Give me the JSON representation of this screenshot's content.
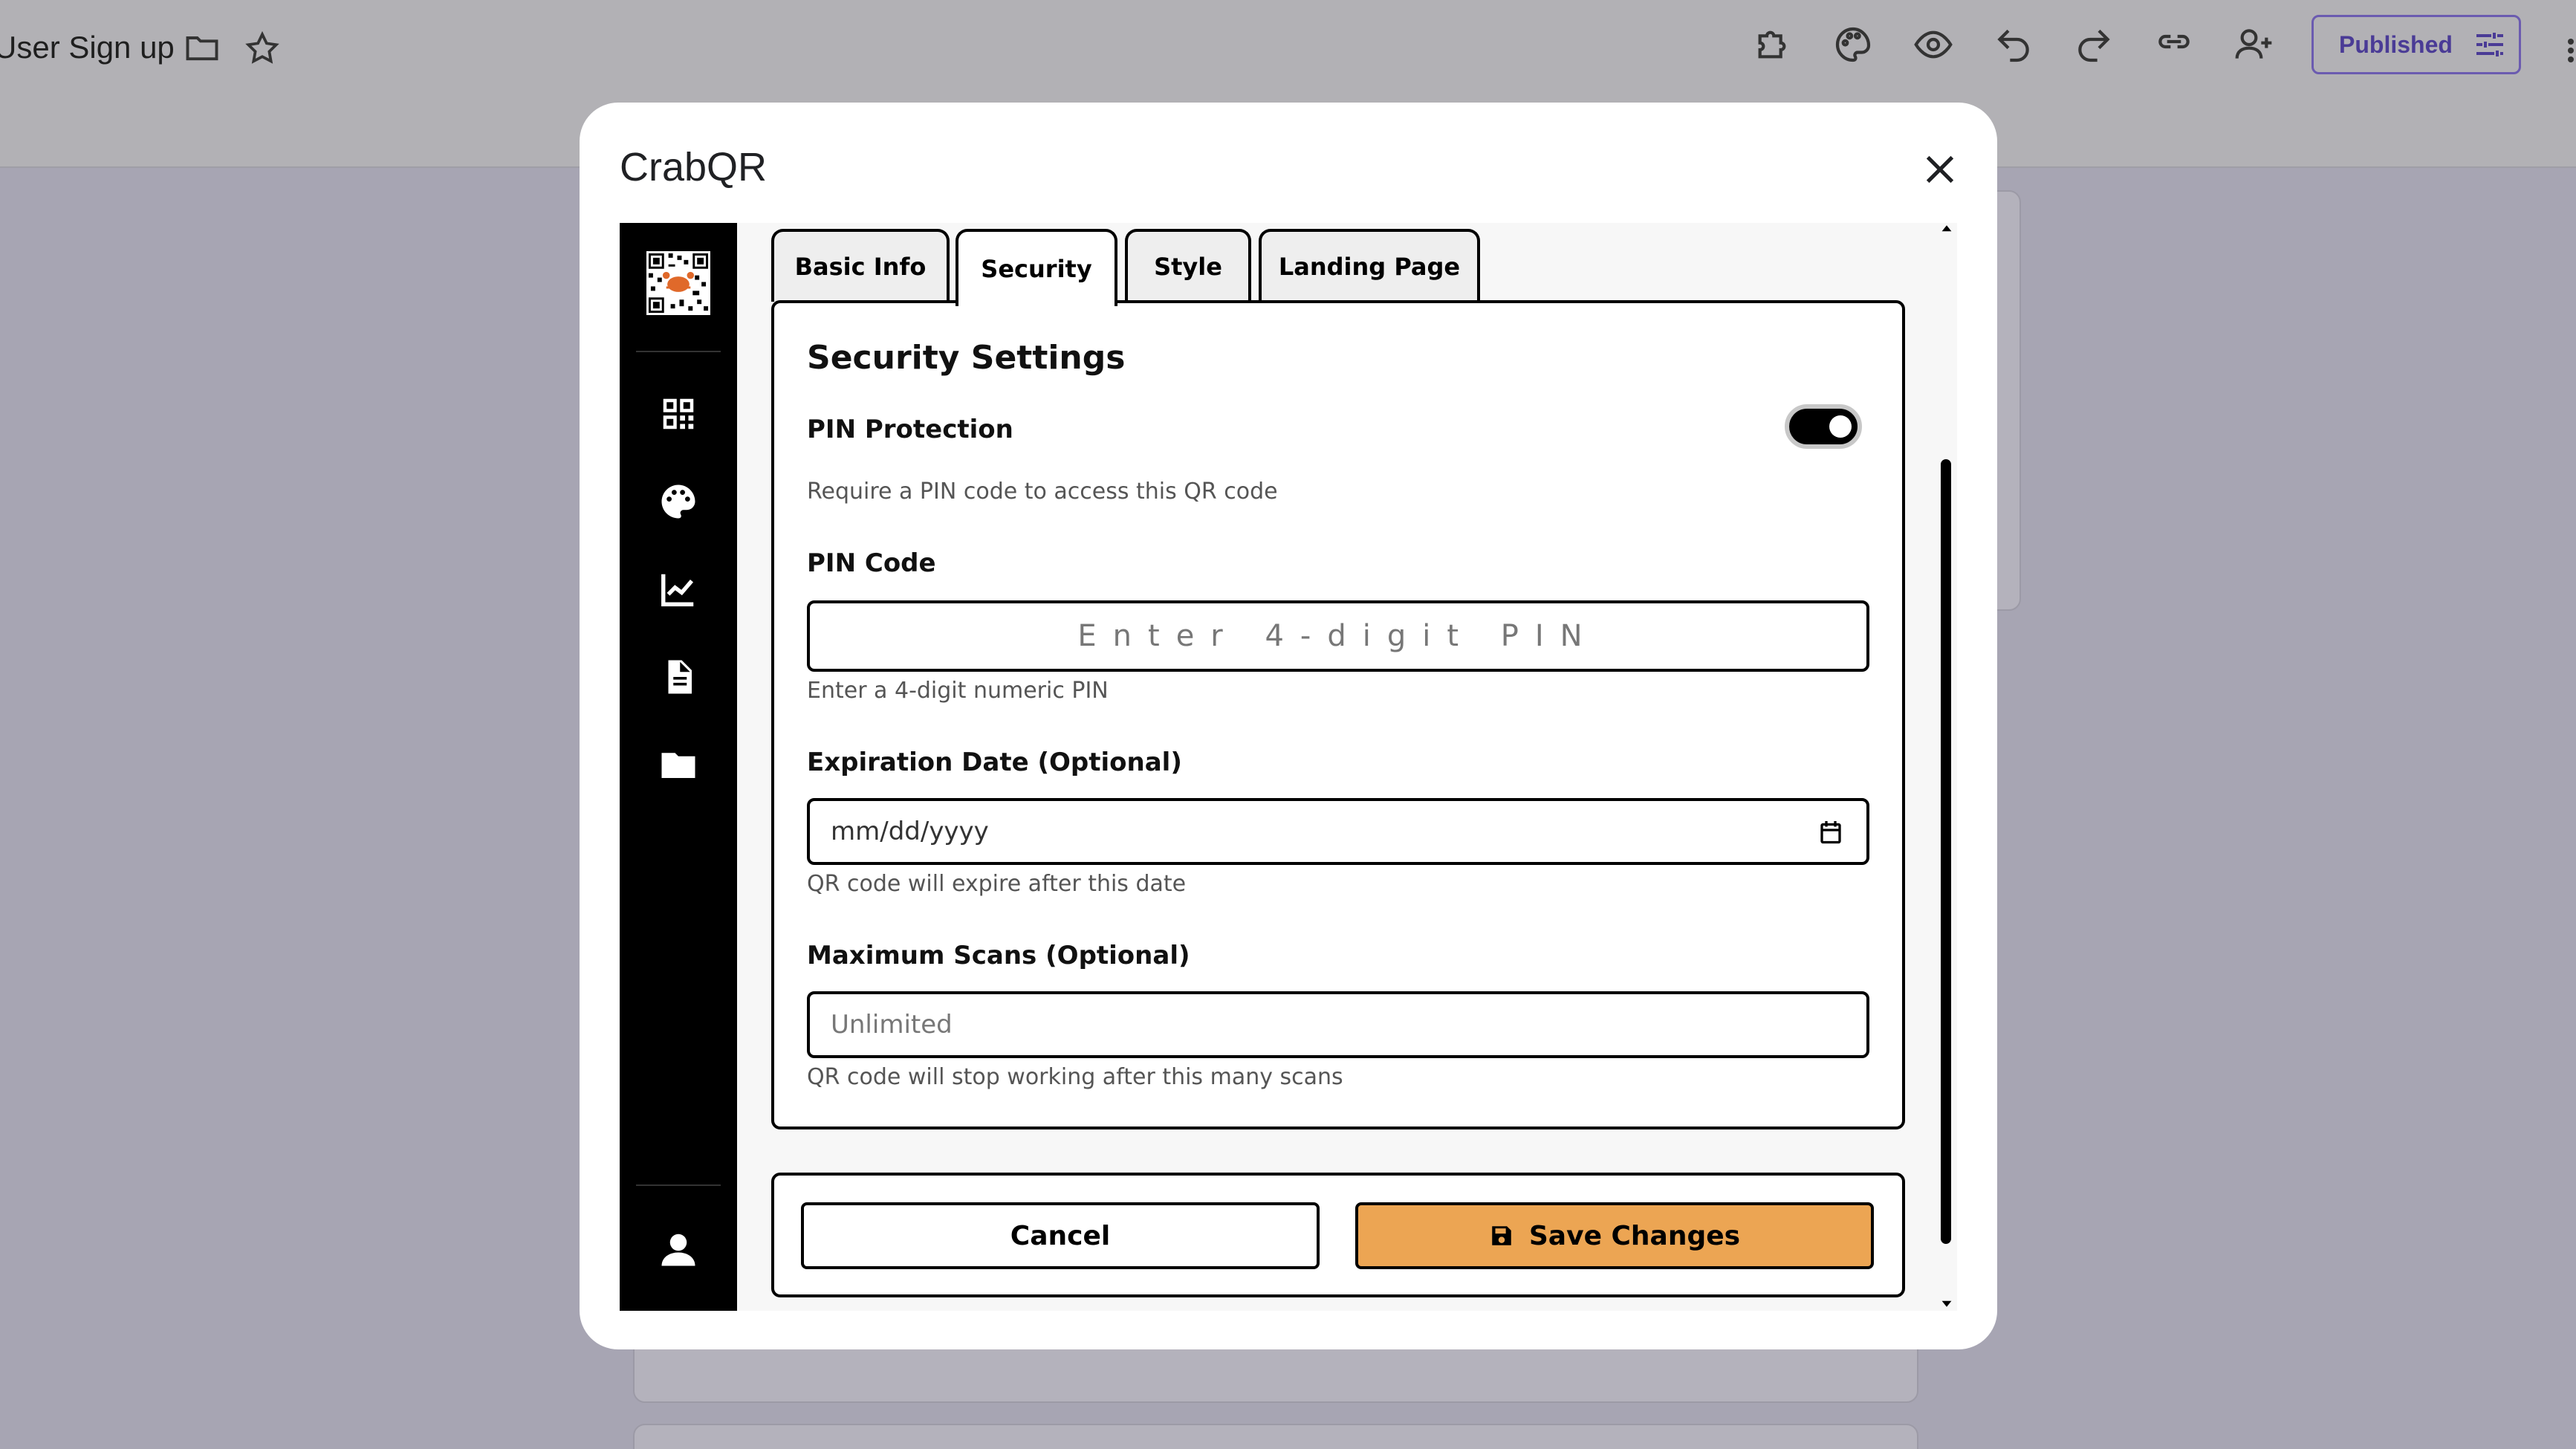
{
  "app_header": {
    "doc_title": "User Sign up",
    "published_label": "Published",
    "icons": [
      "folder-icon",
      "star-icon",
      "addon-icon",
      "palette-icon",
      "preview-icon",
      "undo-icon",
      "redo-icon",
      "link-icon",
      "add-collaborator-icon",
      "tune-icon"
    ]
  },
  "modal": {
    "title": "CrabQR"
  },
  "sidebar": {
    "items": [
      "qr-code-icon",
      "palette-icon",
      "analytics-icon",
      "document-icon",
      "folder-icon",
      "user-icon"
    ]
  },
  "tabs": [
    {
      "label": "Basic Info",
      "active": false
    },
    {
      "label": "Security",
      "active": true
    },
    {
      "label": "Style",
      "active": false
    },
    {
      "label": "Landing Page",
      "active": false
    }
  ],
  "security": {
    "heading": "Security Settings",
    "pin_protection": {
      "label": "PIN Protection",
      "enabled": true,
      "help": "Require a PIN code to access this QR code"
    },
    "pin_code": {
      "label": "PIN Code",
      "placeholder": "Enter 4-digit PIN",
      "value": "",
      "help": "Enter a 4-digit numeric PIN"
    },
    "expiration": {
      "label": "Expiration Date (Optional)",
      "placeholder": "mm/dd/yyyy",
      "help": "QR code will expire after this date"
    },
    "max_scans": {
      "label": "Maximum Scans (Optional)",
      "placeholder": "Unlimited",
      "value": "",
      "help": "QR code will stop working after this many scans"
    }
  },
  "actions": {
    "cancel_label": "Cancel",
    "save_label": "Save Changes"
  },
  "colors": {
    "accent": "#eca553",
    "overlay": "#a7a5b3",
    "sidebar": "#000000"
  }
}
